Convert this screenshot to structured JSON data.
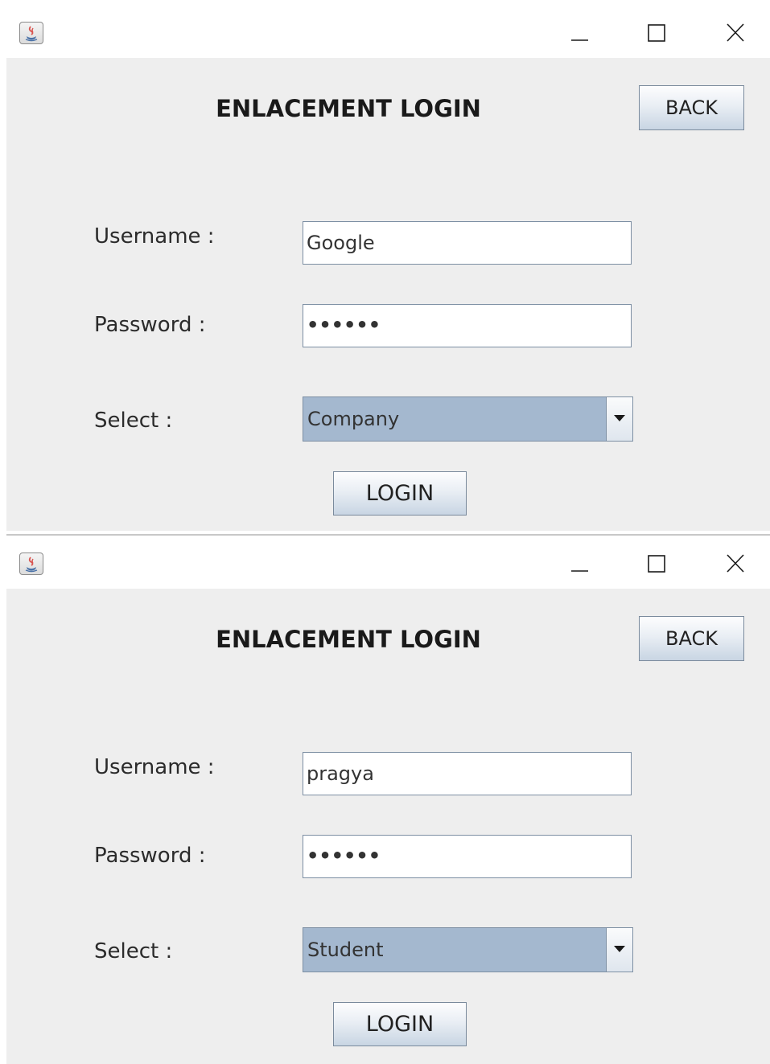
{
  "windows": [
    {
      "heading": "ENLACEMENT LOGIN",
      "back_label": "BACK",
      "username_label": "Username :",
      "password_label": "Password :",
      "select_label": "Select :",
      "username_value": "Google",
      "password_value": "••••••",
      "select_value": "Company",
      "login_label": "LOGIN"
    },
    {
      "heading": "ENLACEMENT LOGIN",
      "back_label": "BACK",
      "username_label": "Username :",
      "password_label": "Password :",
      "select_label": "Select :",
      "username_value": "pragya",
      "password_value": "••••••",
      "select_value": "Student",
      "login_label": "LOGIN"
    }
  ],
  "icons": {
    "app": "java-app-icon",
    "minimize": "minimize-icon",
    "maximize": "maximize-icon",
    "close": "close-icon",
    "dropdown": "dropdown-arrow-icon"
  },
  "colors": {
    "panel_bg": "#eeeeee",
    "select_bg": "#a4b8cf",
    "field_border": "#7d8fa3"
  }
}
